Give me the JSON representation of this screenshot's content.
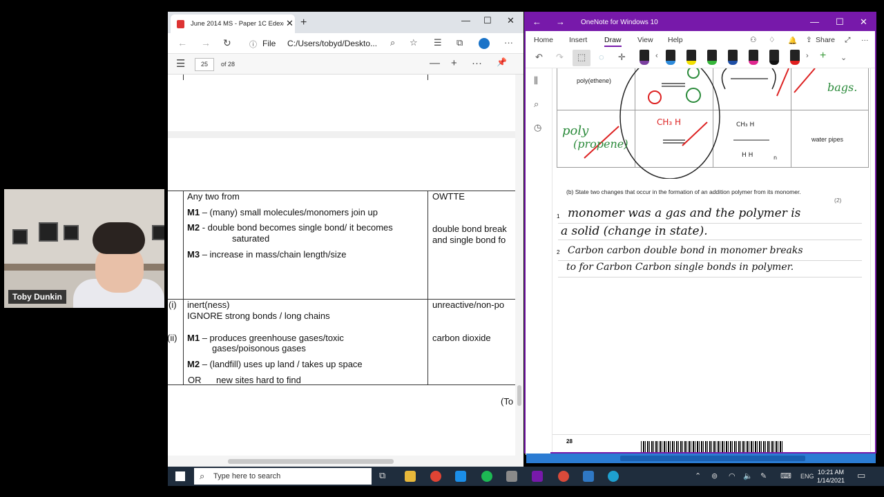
{
  "webcam": {
    "name": "Toby Dunkin"
  },
  "edge": {
    "tab_title": "June 2014 MS - Paper 1C Edexcel",
    "tab_close": "✕",
    "new_tab": "+",
    "win_min": "—",
    "win_max": "☐",
    "win_close": "✕",
    "file_label": "File",
    "url": "C:/Users/tobyd/Deskto...",
    "page_number": "25",
    "page_of": "of 28",
    "zoom_out": "—",
    "zoom_in": "+",
    "more": "···",
    "pin": "📌",
    "ms": {
      "any_two": "Any two from",
      "owtte": "OWTTE",
      "m1_label": "M1",
      "m1_text": "– (many) small molecules/monomers join up",
      "m2_label": "M2",
      "m2_text": "- double bond becomes single bond/ it becomes",
      "m2_text2": "saturated",
      "m3_label": "M3",
      "m3_text": "– increase in mass/chain length/size",
      "right_1": "double bond break",
      "right_2": "and single bond fo",
      "i_label": "(i)",
      "inert": "inert(ness)",
      "ignore": "IGNORE strong bonds / long chains",
      "unreactive": "unreactive/non-po",
      "ii_label": "(ii)",
      "ii_m1_label": "M1",
      "ii_m1_text": "– produces greenhouse gases/toxic",
      "ii_m1_text2": "gases/poisonous gases",
      "co2": "carbon dioxide",
      "ii_m2_label": "M2",
      "ii_m2_text": "– (landfill) uses up land / takes up space",
      "or": "OR",
      "new_sites": "new sites hard to find",
      "total": "(To"
    }
  },
  "onenote": {
    "title": "OneNote for Windows 10",
    "menu": [
      "Home",
      "Insert",
      "Draw",
      "View",
      "Help"
    ],
    "share": "Share",
    "table": {
      "poly_ethene": "poly(ethene)",
      "water_pipes": "water pipes"
    },
    "question_b": "(b)  State two changes that occur in the formation of an addition polymer from its monomer.",
    "marks": "(2)",
    "line1_no": "1",
    "line2_no": "2",
    "ink1a": "monomer was a gas and the polymer is",
    "ink1b": "a solid (change in state).",
    "ink2a": "Carbon carbon double bond in monomer breaks",
    "ink2b": "to for Carbon Carbon single bonds in polymer.",
    "ink_poly": "poly",
    "ink_propene": "(propene)",
    "ink_bags": "bags.",
    "page_footer": "28"
  },
  "taskbar": {
    "search_placeholder": "Type here to search",
    "lang": "ENG",
    "time": "10:21 AM",
    "date": "1/14/2021"
  }
}
